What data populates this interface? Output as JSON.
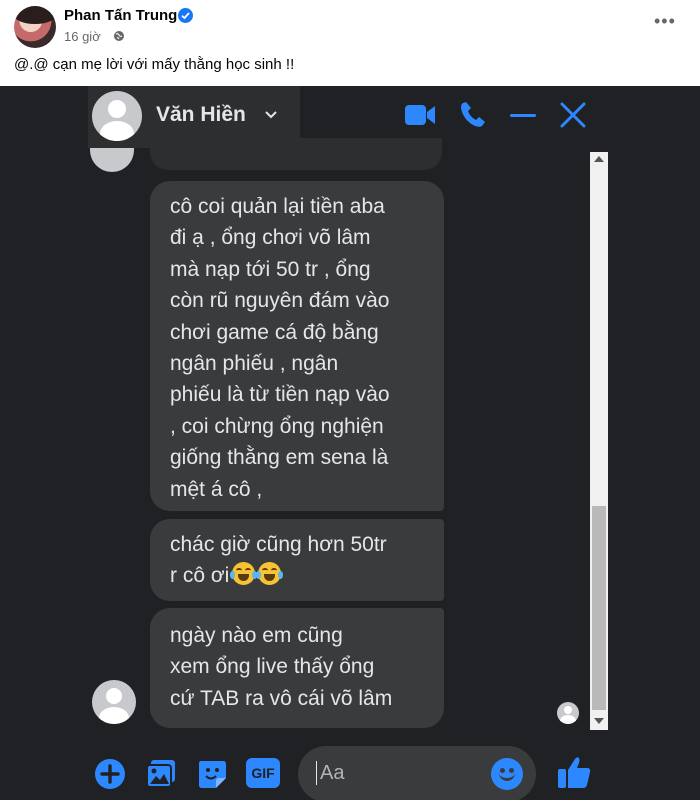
{
  "post": {
    "author_name": "Phan Tấn Trung",
    "time": "16 giờ",
    "caption": "@.@ cạn mẹ lời với mấy thằng học sinh !!",
    "more_icon": "more-horizontal-icon"
  },
  "chat": {
    "contact_name": "Văn Hiền",
    "header_icons": [
      "video-call-icon",
      "phone-call-icon",
      "minimize-icon",
      "close-icon"
    ],
    "messages": [
      {
        "lines": [
          "cô coi quản lại tiền aba",
          "đi ạ , ổng chơi võ lâm",
          "mà nạp tới 50 tr , ổng",
          "còn rũ nguyên đám vào",
          "chơi game cá độ bằng",
          "ngân phiếu , ngân",
          "phiếu là từ tiền nạp vào",
          ", coi chừng ổng nghiện",
          "giống thằng em sena là",
          "mệt á cô ,"
        ]
      },
      {
        "lines": [
          "chác giờ cũng hơn 50tr",
          "r cô ơi"
        ],
        "emoji": "face-with-tears-of-joy-icon"
      },
      {
        "lines": [
          "ngày nào em  cũng",
          "xem ổng live thấy ổng",
          "cứ TAB ra vô cái võ lâm"
        ]
      }
    ],
    "composer": {
      "placeholder": "Aa",
      "icons": [
        "add-icon",
        "photo-icon",
        "sticker-icon",
        "gif-icon",
        "emoji-icon",
        "like-icon"
      ],
      "gif_label": "GIF"
    },
    "accent_color": "#2d88ff",
    "bubble_color": "#3a3b3c"
  }
}
